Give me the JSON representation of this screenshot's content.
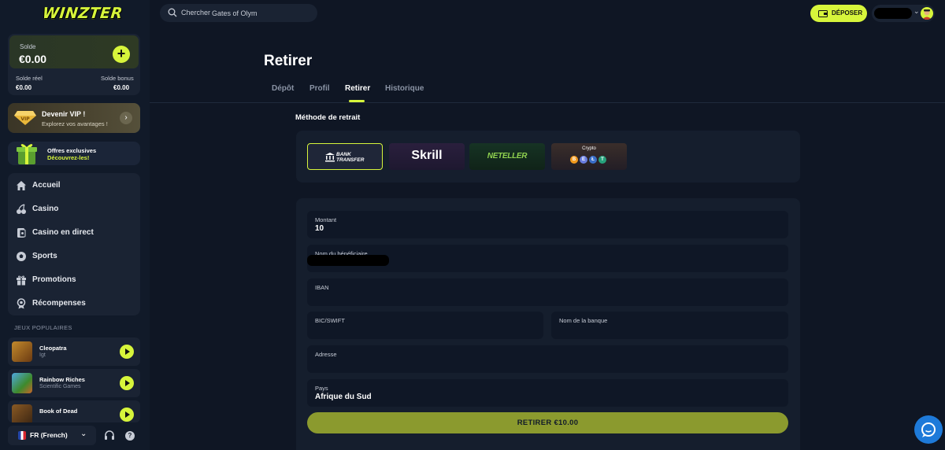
{
  "brand": {
    "logo_text": "WINZTER",
    "accent": "#d7f53b"
  },
  "balance": {
    "label": "Solde",
    "amount": "€0.00",
    "real_label": "Solde réel",
    "real_value": "€0.00",
    "bonus_label": "Solde bonus",
    "bonus_value": "€0.00"
  },
  "vip": {
    "title": "Devenir VIP !",
    "subtitle": "Explorez vos avantages !"
  },
  "offers": {
    "title": "Offres exclusives",
    "subtitle": "Découvrez-les!"
  },
  "nav": [
    {
      "label": "Accueil",
      "icon": "home-icon"
    },
    {
      "label": "Casino",
      "icon": "cherries-icon"
    },
    {
      "label": "Casino en direct",
      "icon": "live-casino-icon"
    },
    {
      "label": "Sports",
      "icon": "soccer-ball-icon"
    },
    {
      "label": "Promotions",
      "icon": "gift-icon"
    },
    {
      "label": "Récompenses",
      "icon": "medal-icon"
    }
  ],
  "popular_games": {
    "title": "JEUX POPULAIRES",
    "items": [
      {
        "title": "Cleopatra",
        "provider": "Igt"
      },
      {
        "title": "Rainbow Riches",
        "provider": "Scientific Games"
      },
      {
        "title": "Book of Dead",
        "provider": ""
      }
    ]
  },
  "language": {
    "label": "FR (French)"
  },
  "search": {
    "prefix": "Chercher",
    "placeholder": "Gates of Olym"
  },
  "header": {
    "deposit_label": "DÉPOSER"
  },
  "page": {
    "title": "Retirer",
    "tabs": [
      {
        "label": "Dépôt",
        "active": false
      },
      {
        "label": "Profil",
        "active": false
      },
      {
        "label": "Retirer",
        "active": true
      },
      {
        "label": "Historique",
        "active": false
      }
    ]
  },
  "withdraw": {
    "method_title": "Méthode de retrait",
    "methods": {
      "bank": {
        "line1": "BANK",
        "line2": "TRANSFER",
        "selected": true
      },
      "skrill": {
        "label": "Skrill"
      },
      "neteller": {
        "label": "NETELLER"
      },
      "crypto": {
        "label": "Crypto",
        "coins": [
          "B",
          "E",
          "Ł",
          "T"
        ]
      }
    },
    "fields": {
      "amount": {
        "label": "Montant",
        "value": "10"
      },
      "beneficiary": {
        "label": "Nom du bénéficiaire",
        "value": ""
      },
      "iban": {
        "label": "IBAN",
        "value": ""
      },
      "bic": {
        "label": "BIC/SWIFT",
        "value": ""
      },
      "bank_name": {
        "label": "Nom de la banque",
        "value": ""
      },
      "address": {
        "label": "Adresse",
        "value": ""
      },
      "country": {
        "label": "Pays",
        "value": "Afrique du Sud"
      }
    },
    "submit_label": "RETIRER €10.00"
  }
}
